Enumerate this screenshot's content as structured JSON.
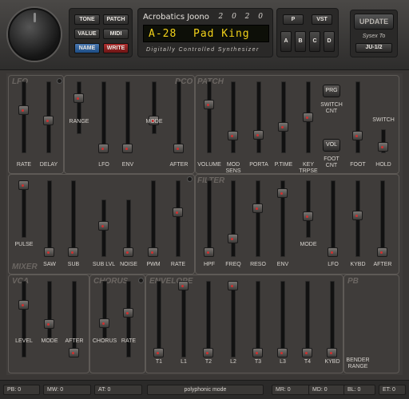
{
  "top": {
    "tone_label": "TONE",
    "patch_label": "PATCH",
    "value_label": "VALUE",
    "midi_label": "MIDI",
    "name_label": "NAME",
    "write_label": "WRITE",
    "brand": "Acrobatics Joono",
    "year": "2 0 2 0",
    "lcd_patch_number": "A-28",
    "lcd_patch_name": "Pad King",
    "subtitle": "Digitally Controlled Synthesizer",
    "p_label": "P",
    "vst_label": "VST",
    "bank_a": "A",
    "bank_b": "B",
    "bank_c": "C",
    "bank_d": "D",
    "update_label": "UPDATE",
    "sysex_label": "Sysex To",
    "sysex_target": "JU-1/2"
  },
  "sections": {
    "lfo": "LFO",
    "dco": "DCO",
    "patch": "PATCH",
    "filter": "FILTER",
    "mixer": "MIXER",
    "vca": "VCA",
    "chorus": "CHORUS",
    "envelope": "ENVELOPE",
    "pb": "PB"
  },
  "sliders": {
    "lfo_rate": {
      "label": "RATE",
      "value": 0.62
    },
    "lfo_delay": {
      "label": "DELAY",
      "value": 0.45
    },
    "dco_range": {
      "label": "RANGE",
      "value": 0.72
    },
    "dco_lfo": {
      "label": "LFO",
      "value": 0.0
    },
    "dco_env": {
      "label": "ENV",
      "value": 0.0
    },
    "dco_mode": {
      "label": "MODE",
      "value": 0.2
    },
    "dco_after": {
      "label": "AFTER",
      "value": 0.0
    },
    "patch_volume": {
      "label": "VOLUME",
      "value": 0.7
    },
    "patch_modsens": {
      "label": "MOD\nSENS",
      "value": 0.2
    },
    "patch_porta": {
      "label": "PORTA",
      "value": 0.22
    },
    "patch_ptime": {
      "label": "P.TIME",
      "value": 0.35
    },
    "patch_keytrpse": {
      "label": "KEY\nTRPSE",
      "value": 0.5
    },
    "patch_foot": {
      "label": "FOOT",
      "value": 0.2
    },
    "patch_hold": {
      "label": "HOLD",
      "value": 0.12
    },
    "mixer_pulse": {
      "label": "PULSE",
      "value": 1.0
    },
    "mixer_saw": {
      "label": "SAW",
      "value": 0.0
    },
    "mixer_sub": {
      "label": "SUB",
      "value": 0.0
    },
    "mixer_sublvl": {
      "label": "SUB LVL",
      "value": 0.55
    },
    "mixer_noise": {
      "label": "NOISE",
      "value": 0.0
    },
    "mixer_pwm": {
      "label": "PWM",
      "value": 0.0
    },
    "mixer_rate": {
      "label": "RATE",
      "value": 0.6
    },
    "filter_hpf": {
      "label": "HPF",
      "value": 0.0
    },
    "filter_freq": {
      "label": "FREQ",
      "value": 0.2
    },
    "filter_reso": {
      "label": "RESO",
      "value": 0.65
    },
    "filter_env": {
      "label": "ENV",
      "value": 0.88
    },
    "filter_mode": {
      "label": "MODE",
      "value": 0.35
    },
    "filter_lfo": {
      "label": "LFO",
      "value": 0.0
    },
    "filter_kybd": {
      "label": "KYBD",
      "value": 0.55
    },
    "filter_after": {
      "label": "AFTER",
      "value": 0.0
    },
    "vca_level": {
      "label": "LEVEL",
      "value": 0.72
    },
    "vca_mode": {
      "label": "MODE",
      "value": 0.2
    },
    "vca_after": {
      "label": "AFTER",
      "value": 0.0
    },
    "chorus_chorus": {
      "label": "CHORUS",
      "value": 0.22
    },
    "chorus_rate": {
      "label": "RATE",
      "value": 0.6
    },
    "env_t1": {
      "label": "T1",
      "value": 0.0
    },
    "env_l1": {
      "label": "L1",
      "value": 1.0
    },
    "env_t2": {
      "label": "T2",
      "value": 0.0
    },
    "env_l2": {
      "label": "L2",
      "value": 1.0
    },
    "env_t3": {
      "label": "T3",
      "value": 0.0
    },
    "env_l3": {
      "label": "L3",
      "value": 0.0
    },
    "env_t4": {
      "label": "T4",
      "value": 0.0
    },
    "env_kybd": {
      "label": "KYBD",
      "value": 0.0
    }
  },
  "buttons": {
    "prg_label": "PRG",
    "switch_cnt_label": "SWITCH\nCNT",
    "vol_label": "VOL",
    "foot_cnt_label": "FOOT\nCNT",
    "switch_label": "SWITCH",
    "bender_range_label": "BENDER\nRANGE"
  },
  "status": {
    "pb": "PB: 0",
    "mw": "MW: 0",
    "at": "AT: 0",
    "mode": "polyphonic mode",
    "mr": "MR: 0",
    "md": "MD: 0",
    "bl": "BL: 0",
    "et": "ET: 0"
  }
}
